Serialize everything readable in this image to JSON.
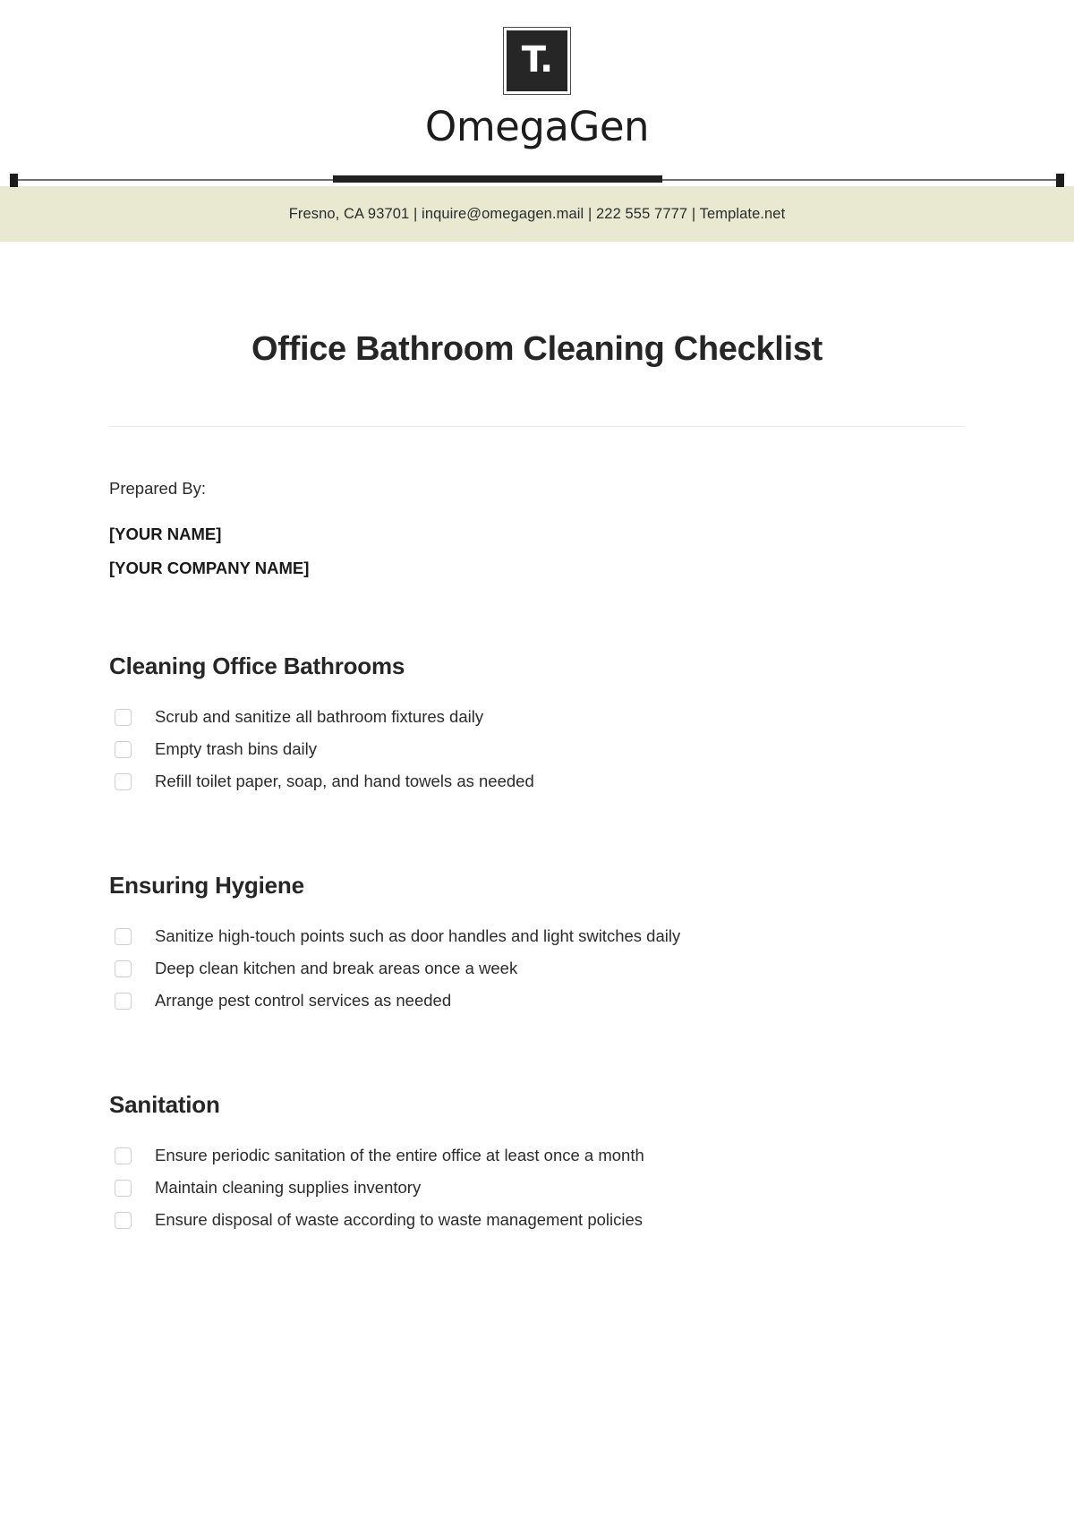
{
  "brand": {
    "logo_glyph": "T.",
    "name": "OmegaGen"
  },
  "contact": {
    "line": "Fresno, CA 93701 | inquire@omegagen.mail | 222 555 7777 | Template.net"
  },
  "document": {
    "title": "Office Bathroom Cleaning Checklist"
  },
  "prepared_by": {
    "label": "Prepared By:",
    "name": "[YOUR NAME]",
    "company": "[YOUR COMPANY NAME]"
  },
  "sections": [
    {
      "heading": "Cleaning Office Bathrooms",
      "items": [
        "Scrub and sanitize all bathroom fixtures daily",
        "Empty trash bins daily",
        "Refill toilet paper, soap, and hand towels as needed"
      ]
    },
    {
      "heading": "Ensuring Hygiene",
      "items": [
        "Sanitize high-touch points such as door handles and light switches daily",
        "Deep clean kitchen and break areas once a week",
        "Arrange pest control services as needed"
      ]
    },
    {
      "heading": "Sanitation",
      "items": [
        "Ensure periodic sanitation of the entire office at least once a month",
        "Maintain cleaning supplies inventory",
        "Ensure disposal of waste according to waste management policies"
      ]
    }
  ],
  "colors": {
    "band": "#e9e9d2",
    "ink": "#2b2b2b",
    "logo_bg": "#262626",
    "checkbox_border": "#cfcfcf",
    "divider": "#e9e9e9"
  }
}
